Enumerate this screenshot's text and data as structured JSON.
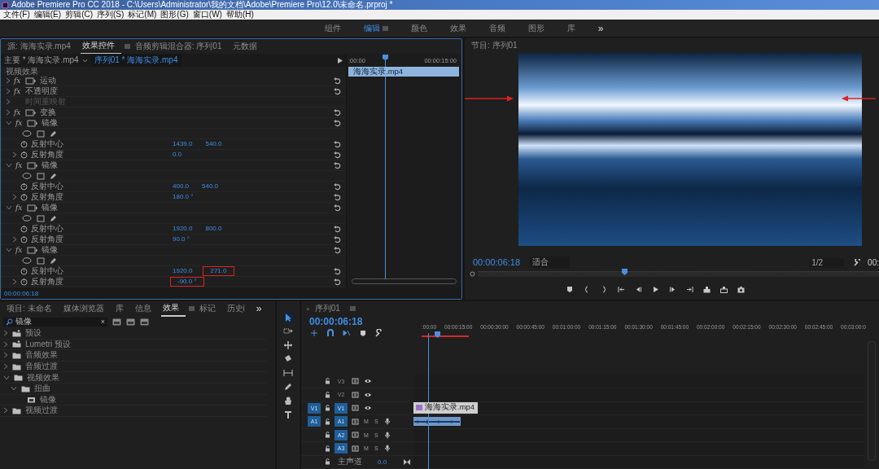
{
  "window": {
    "title": "Adobe Premiere Pro CC 2018 - C:\\Users\\Administrator\\我的文档\\Adobe\\Premiere Pro\\12.0\\未命名.prproj *"
  },
  "menu": [
    "文件(F)",
    "编辑(E)",
    "剪辑(C)",
    "序列(S)",
    "标记(M)",
    "图形(G)",
    "窗口(W)",
    "帮助(H)"
  ],
  "workspaces": [
    {
      "label": "组件",
      "selected": false
    },
    {
      "label": "编辑",
      "selected": true
    },
    {
      "label": "颜色",
      "selected": false
    },
    {
      "label": "效果",
      "selected": false
    },
    {
      "label": "音频",
      "selected": false
    },
    {
      "label": "图形",
      "selected": false
    },
    {
      "label": "库",
      "selected": false
    }
  ],
  "workspace_overflow": "»",
  "effect_controls": {
    "tabs": [
      {
        "label": "源: 海海实录.mp4",
        "selected": false
      },
      {
        "label": "效果控件",
        "selected": true
      },
      {
        "label": "音频剪辑混合器: 序列01",
        "selected": false
      },
      {
        "label": "元数据",
        "selected": false
      }
    ],
    "master_clip": "主要 * 海海实录.mp4",
    "sequence_clip": "序列01 * 海海实录.mp4",
    "section": "视频效果",
    "effects": [
      {
        "name": "运动",
        "badge": "fx",
        "kind": "box",
        "expanded": false
      },
      {
        "name": "不透明度",
        "badge": "fx",
        "kind": "plain",
        "expanded": false
      },
      {
        "name": "时间重映射",
        "kind": "remap",
        "expanded": false
      },
      {
        "name": "变换",
        "badge": "fx",
        "kind": "box",
        "expanded": false
      },
      {
        "name": "镜像",
        "badge": "fx",
        "kind": "box",
        "expanded": true,
        "params": [
          {
            "name": "反射中心",
            "expandable": false,
            "values": [
              {
                "text": "1439.0",
                "highlighted": false
              },
              {
                "text": "540.0",
                "highlighted": false
              }
            ]
          },
          {
            "name": "反射角度",
            "expandable": true,
            "values": [
              {
                "text": "0.0",
                "highlighted": false
              }
            ]
          }
        ]
      },
      {
        "name": "镜像",
        "badge": "fx",
        "kind": "box",
        "expanded": true,
        "params": [
          {
            "name": "反射中心",
            "expandable": false,
            "values": [
              {
                "text": "400.0",
                "highlighted": false
              },
              {
                "text": "540.0",
                "highlighted": false
              }
            ]
          },
          {
            "name": "反射角度",
            "expandable": true,
            "values": [
              {
                "text": "180.0 °",
                "highlighted": false
              }
            ]
          }
        ]
      },
      {
        "name": "镜像",
        "badge": "fx",
        "kind": "box",
        "expanded": true,
        "params": [
          {
            "name": "反射中心",
            "expandable": false,
            "values": [
              {
                "text": "1920.0",
                "highlighted": false
              },
              {
                "text": "800.0",
                "highlighted": false
              }
            ]
          },
          {
            "name": "反射角度",
            "expandable": true,
            "values": [
              {
                "text": "90.0 °",
                "highlighted": false
              }
            ]
          }
        ]
      },
      {
        "name": "镜像",
        "badge": "fx",
        "kind": "box",
        "expanded": true,
        "params": [
          {
            "name": "反射中心",
            "expandable": false,
            "values": [
              {
                "text": "1920.0",
                "highlighted": false
              },
              {
                "text": "271.0",
                "highlighted": true
              }
            ]
          },
          {
            "name": "反射角度",
            "expandable": true,
            "values": [
              {
                "text": "-90.0 °",
                "highlighted": true
              }
            ]
          }
        ]
      }
    ],
    "ruler": [
      ":00:00",
      "00:00:15:00"
    ],
    "clip": "海海实录.mp4",
    "timecode": "00:00:06:18"
  },
  "program_monitor": {
    "title": "节目: 序列01",
    "timecode": "00:00:06:18",
    "zoom": "适合",
    "resolution": "1/2",
    "duration": "00:"
  },
  "project_panel": {
    "tabs": [
      {
        "label": "项目: 未命名",
        "selected": false
      },
      {
        "label": "媒体浏览器",
        "selected": false
      },
      {
        "label": "库",
        "selected": false
      },
      {
        "label": "信息",
        "selected": false
      },
      {
        "label": "效果",
        "selected": true
      },
      {
        "label": "标记",
        "selected": false
      },
      {
        "label": "历史i",
        "selected": false
      }
    ],
    "overflow": "»",
    "search": {
      "value": "镜像",
      "clear": "×"
    },
    "tree": [
      {
        "label": "预设",
        "kind": "preset",
        "expanded": false
      },
      {
        "label": "Lumetri 预设",
        "kind": "preset",
        "expanded": false
      },
      {
        "label": "音频效果",
        "kind": "folder",
        "expanded": false
      },
      {
        "label": "音频过渡",
        "kind": "folder",
        "expanded": false
      },
      {
        "label": "视频效果",
        "kind": "folder",
        "expanded": true,
        "children": [
          {
            "label": "扭曲",
            "kind": "folder",
            "expanded": true,
            "children": [
              {
                "label": "镜像",
                "kind": "effect"
              }
            ]
          }
        ]
      },
      {
        "label": "视频过渡",
        "kind": "folder",
        "expanded": false
      }
    ]
  },
  "timeline": {
    "tab": "序列01",
    "close": "×",
    "timecode": "00:00:06:18",
    "ruler": [
      ":00:00",
      "00:00:15:00",
      "00:00:30:00",
      "00:00:45:00",
      "00:01:00:00",
      "00:01:15:00",
      "00:01:30:00",
      "00:01:45:00",
      "00:02:00:00",
      "00:02:15:00",
      "00:02:30:00",
      "00:02:45:00",
      "00:03:00:0"
    ],
    "tracks": [
      {
        "name": "V3",
        "kind": "video",
        "targeted": false
      },
      {
        "name": "V2",
        "kind": "video",
        "targeted": false
      },
      {
        "name": "V1",
        "kind": "video",
        "targeted": true,
        "source_patch": "V1",
        "clip": {
          "label": "海海实录.mp4"
        }
      },
      {
        "name": "A1",
        "kind": "audio",
        "targeted": true,
        "source_patch": "A1",
        "mute": "M",
        "solo": "S",
        "clip": {
          "waveform": true
        }
      },
      {
        "name": "A2",
        "kind": "audio",
        "targeted": true,
        "mute": "M",
        "solo": "S"
      },
      {
        "name": "A3",
        "kind": "audio",
        "targeted": true,
        "mute": "M",
        "solo": "S"
      }
    ],
    "master": {
      "label": "主声道",
      "value": "0.0"
    }
  }
}
